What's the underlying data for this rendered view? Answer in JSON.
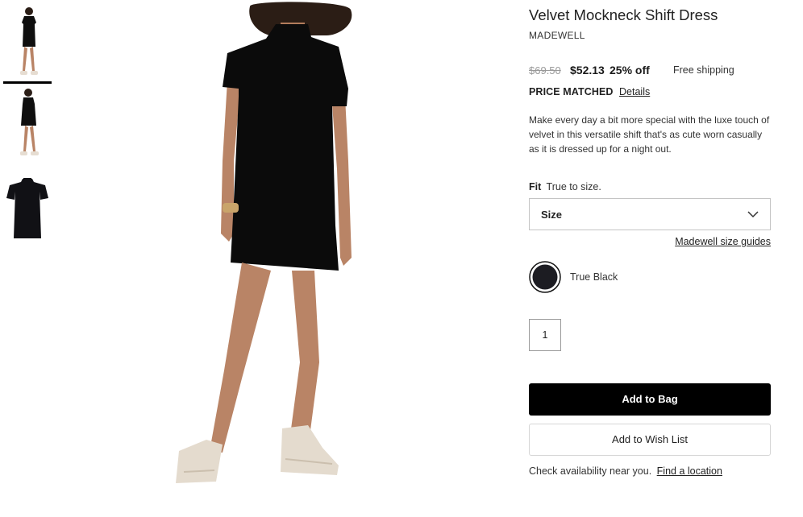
{
  "product": {
    "title": "Velvet Mockneck Shift Dress",
    "brand": "MADEWELL"
  },
  "pricing": {
    "original": "$69.50",
    "sale": "$52.13",
    "discount": "25% off",
    "shipping": "Free shipping",
    "price_matched_label": "PRICE MATCHED",
    "details_link": "Details"
  },
  "description": "Make every day a bit more special with the luxe touch of velvet in this versatile shift that's as cute worn casually as it is dressed up for a night out.",
  "fit": {
    "label": "Fit",
    "value": "True to size."
  },
  "size_select": {
    "label": "Size",
    "guide_link": "Madewell size guides"
  },
  "color": {
    "name": "True Black",
    "swatch": "#1c1c22"
  },
  "quantity": "1",
  "actions": {
    "add_to_bag": "Add to Bag",
    "add_to_wishlist": "Add to Wish List"
  },
  "availability": {
    "text": "Check availability near you.",
    "link": "Find a location"
  },
  "thumbnails": [
    {
      "view": "front-full-body",
      "selected": true
    },
    {
      "view": "side-full-body",
      "selected": false
    },
    {
      "view": "flat-lay",
      "selected": false
    }
  ],
  "colors": {
    "accent_button": "#000000",
    "price_strike": "#999999"
  }
}
